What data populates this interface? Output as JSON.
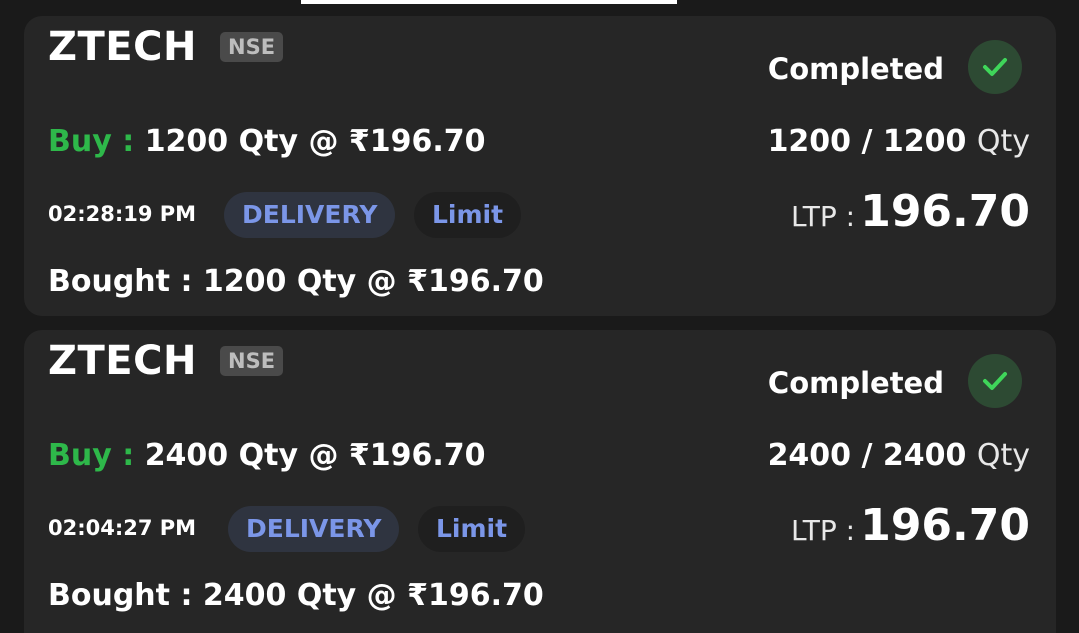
{
  "orders": [
    {
      "symbol": "ZTECH",
      "exchange": "NSE",
      "status": "Completed",
      "side_label": "Buy :",
      "order_detail": "1200 Qty @ ₹196.70",
      "filled": "1200 / 1200",
      "qty_unit": "Qty",
      "time": "02:28:19 PM",
      "product": "DELIVERY",
      "order_type": "Limit",
      "ltp_label": "LTP :",
      "ltp_value": "196.70",
      "bought": "Bought : 1200 Qty @ ₹196.70"
    },
    {
      "symbol": "ZTECH",
      "exchange": "NSE",
      "status": "Completed",
      "side_label": "Buy :",
      "order_detail": "2400 Qty @ ₹196.70",
      "filled": "2400 / 2400",
      "qty_unit": "Qty",
      "time": "02:04:27 PM",
      "product": "DELIVERY",
      "order_type": "Limit",
      "ltp_label": "LTP :",
      "ltp_value": "196.70",
      "bought": "Bought : 2400 Qty @ ₹196.70"
    }
  ],
  "colors": {
    "background": "#1a1a1a",
    "card": "#262626",
    "buy": "#2eb84a",
    "chip_text": "#7b96e8",
    "check": "#3fd65a"
  },
  "icons": {
    "status": "check-icon"
  }
}
